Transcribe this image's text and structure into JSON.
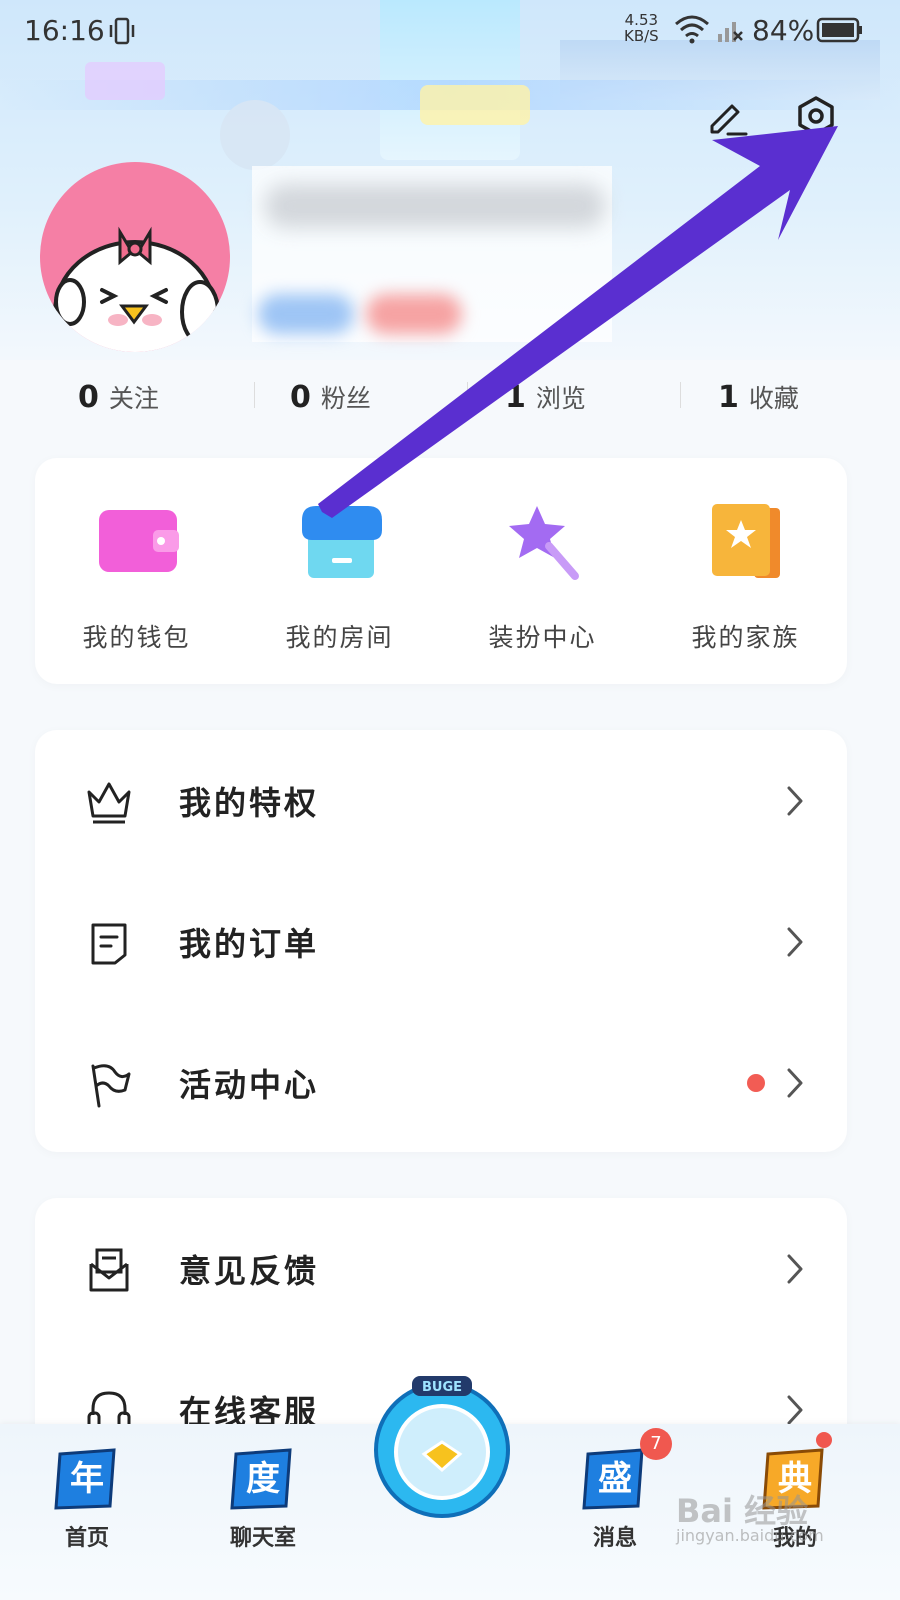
{
  "status_bar": {
    "time": "16:16",
    "net_speed_value": "4.53",
    "net_speed_unit": "KB/S",
    "battery": "84%"
  },
  "header": {
    "edit_icon": "pencil-icon",
    "camera_icon": "camera-icon"
  },
  "stats": [
    {
      "count": "0",
      "label": "关注"
    },
    {
      "count": "0",
      "label": "粉丝"
    },
    {
      "count": "1",
      "label": "浏览"
    },
    {
      "count": "1",
      "label": "收藏"
    }
  ],
  "quick_actions": [
    {
      "label": "我的钱包",
      "icon": "wallet-icon",
      "color": "#f25fd9"
    },
    {
      "label": "我的房间",
      "icon": "room-store-icon",
      "color": "#3fb4f2"
    },
    {
      "label": "装扮中心",
      "icon": "magic-wand-icon",
      "color": "#a36bf2"
    },
    {
      "label": "我的家族",
      "icon": "family-book-icon",
      "color": "#f7b53b"
    }
  ],
  "menu_group1": [
    {
      "label": "我的特权",
      "icon": "crown-icon"
    },
    {
      "label": "我的订单",
      "icon": "order-icon"
    },
    {
      "label": "活动中心",
      "icon": "flag-icon",
      "has_dot": true
    }
  ],
  "menu_group2": [
    {
      "label": "意见反馈",
      "icon": "feedback-mail-icon"
    },
    {
      "label": "在线客服",
      "icon": "headset-icon"
    }
  ],
  "tabbar": {
    "tabs": [
      {
        "label": "首页",
        "glyph": "年"
      },
      {
        "label": "聊天室",
        "glyph": "度"
      },
      {
        "label": "消息",
        "glyph": "盛"
      },
      {
        "label": "我的",
        "glyph": "典"
      }
    ],
    "center_glyph": "BUGE",
    "message_badge": "7"
  },
  "watermark": {
    "text": "Bai 经验",
    "url": "jingyan.baidu.com"
  },
  "colors": {
    "accent_red": "#f25c54",
    "arrow": "#5a2fd0"
  }
}
